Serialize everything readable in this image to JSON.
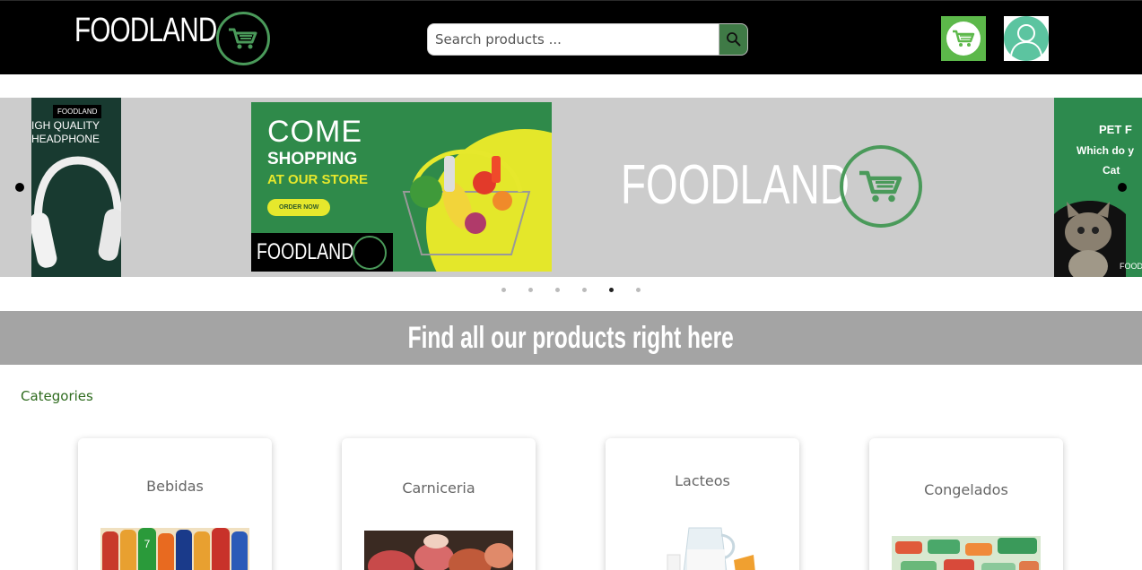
{
  "header": {
    "brand": "FOODLAND",
    "search": {
      "placeholder": "Search products ..."
    },
    "icons": {
      "logo": "cart-logo-icon",
      "search": "magnifier-icon",
      "cart": "cart-icon",
      "user": "user-icon"
    },
    "colors": {
      "background": "#000000",
      "accent": "#5cb84a",
      "search_button": "#3f7a46",
      "avatar": "#5cc4a0"
    }
  },
  "carousel": {
    "left_slide": {
      "tag": "FOODLAND",
      "line1": "IGH QUALITY",
      "line2": "HEADPHONE"
    },
    "main_slide": {
      "line1": "COME",
      "line2": "SHOPPING",
      "line3": "AT OUR STORE",
      "button": "ORDER NOW",
      "footer": "FOODLAND"
    },
    "center_brand": "FOODLAND",
    "right_slide": {
      "line1": "PET F",
      "line2": "Which do y",
      "line3": "Cat",
      "footer": "FOODL"
    },
    "indicators": 6,
    "active_indicator": 5
  },
  "banner": {
    "text": "Find all our products right here",
    "color": "#a4a4a4"
  },
  "categories": {
    "title": "Categories",
    "items": [
      {
        "name": "Bebidas",
        "image": "drink-bottles"
      },
      {
        "name": "Carniceria",
        "image": "meat-cuts"
      },
      {
        "name": "Lacteos",
        "image": "milk-jug"
      },
      {
        "name": "Congelados",
        "image": "frozen-vegetables"
      }
    ]
  }
}
